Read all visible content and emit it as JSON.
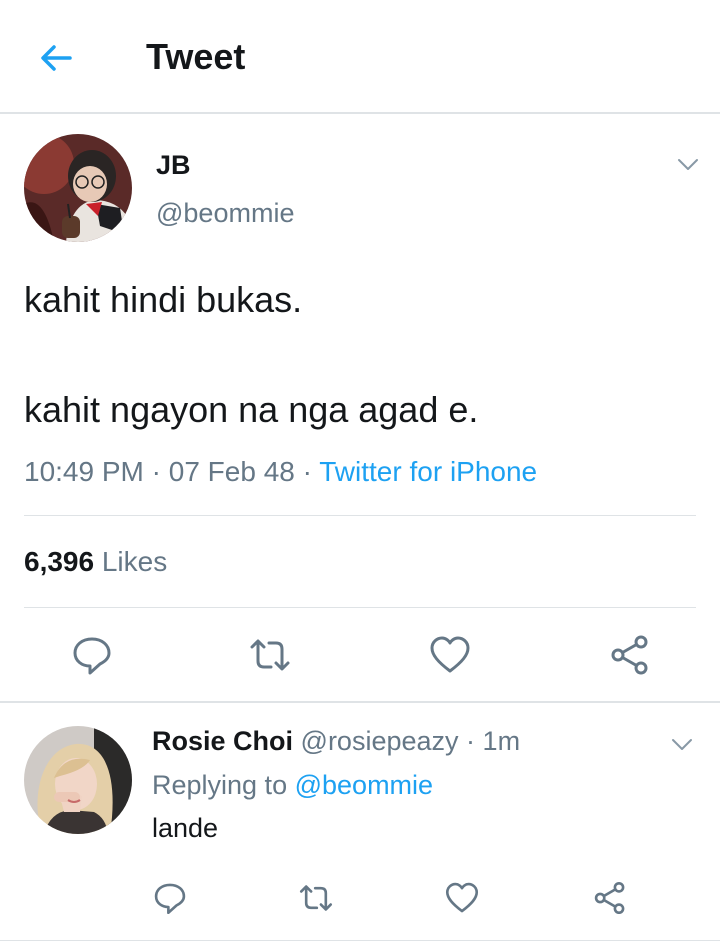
{
  "header": {
    "title": "Tweet"
  },
  "tweet": {
    "author_name": "JB",
    "author_handle": "@beommie",
    "line1": "kahit hindi bukas.",
    "line2": "kahit ngayon na nga agad e.",
    "time": "10:49 PM",
    "date": "07 Feb 48",
    "source": "Twitter for iPhone",
    "likes_count": "6,396",
    "likes_label": "Likes"
  },
  "reply": {
    "author_name": "Rosie Choi",
    "author_handle": "@rosiepeazy",
    "time": "1m",
    "replying_prefix": "Replying to",
    "replying_to": "@beommie",
    "text": "lande"
  },
  "colors": {
    "accent": "#1da1f2",
    "muted": "#657786",
    "text": "#14171a",
    "divider": "#dfe3e6"
  }
}
